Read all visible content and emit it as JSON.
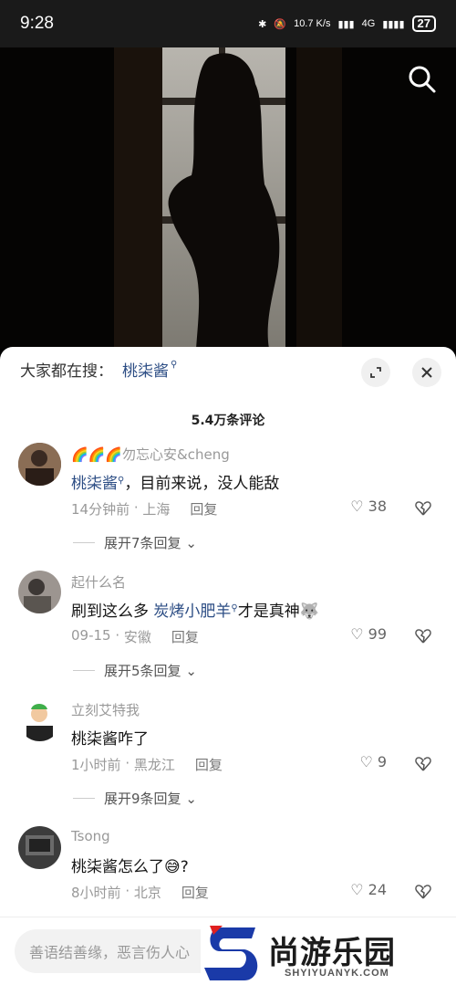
{
  "status": {
    "time": "9:28",
    "net_speed": "10.7 K/s",
    "network": "4G",
    "battery": "27"
  },
  "hot_search": {
    "label": "大家都在搜：",
    "keyword": "桃柒酱"
  },
  "comments_count": "5.4万条评论",
  "comments": [
    {
      "user": "🌈🌈🌈勿忘心安&cheng",
      "text_kw": "桃柒酱",
      "text_rest": "，目前来说，没人能敌",
      "time": "14分钟前",
      "location": "上海",
      "reply": "回复",
      "likes": "38",
      "expand": "展开7条回复"
    },
    {
      "user": "起什么名",
      "text_pre": "刷到这么多 ",
      "text_kw": "炭烤小肥羊",
      "text_rest": "才是真神",
      "time": "09-15",
      "location": "安徽",
      "reply": "回复",
      "likes": "99",
      "expand": "展开5条回复"
    },
    {
      "user": "立刻艾特我",
      "text": "桃柒酱咋了",
      "time": "1小时前",
      "location": "黑龙江",
      "reply": "回复",
      "likes": "9",
      "expand": "展开9条回复"
    },
    {
      "user": "Tsong",
      "text": "桃柒酱怎么了",
      "text_end": "?",
      "time": "8小时前",
      "location": "北京",
      "reply": "回复",
      "likes": "24"
    }
  ],
  "input_placeholder": "善语结善缘，恶言伤人心",
  "watermark": {
    "title": "尚游乐园",
    "sub": "SHYIYUANYK.COM"
  },
  "colors": {
    "keyword": "#2c4d84",
    "meta": "#999999"
  },
  "icons": [
    "search-icon",
    "expand-icon",
    "close-icon",
    "heart-icon",
    "broken-heart-icon",
    "chevron-down-icon"
  ]
}
